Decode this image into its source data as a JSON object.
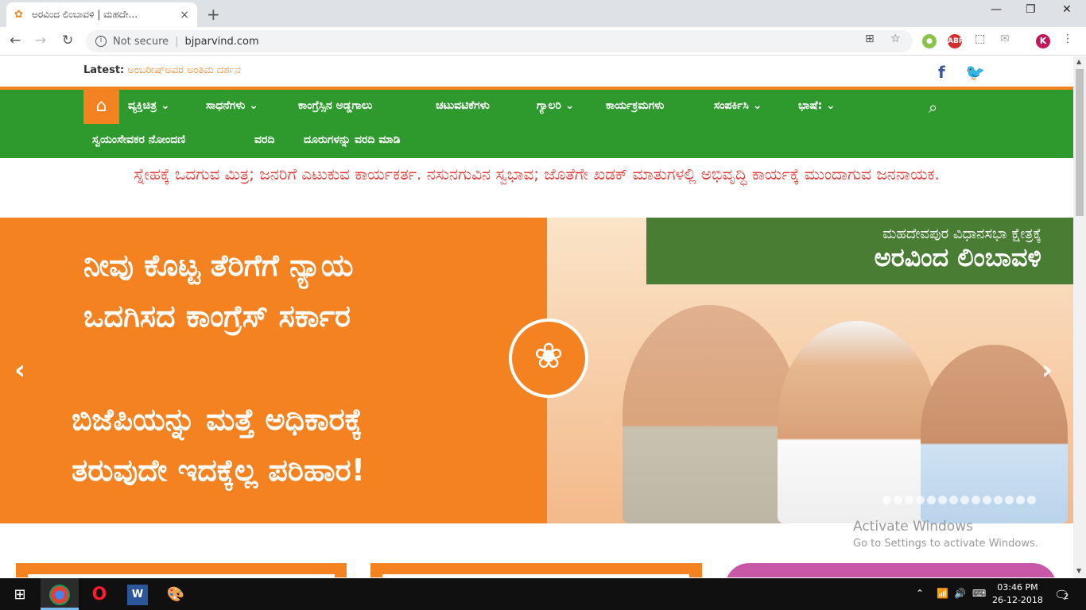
{
  "browser": {
    "tab_title": "ಅರವಿಂದ ಲಿಂಬಾವಳಿ | ಮಹದೇ...",
    "tab_close": "×",
    "new_tab": "+",
    "url_security": "Not secure",
    "url": "bjparvind.com",
    "profile_initial": "K",
    "ext_abp": "ABP"
  },
  "site": {
    "latest_label": "Latest:",
    "latest_text": "ಅಂಬರೀಷ್‌ಅವರ ಅಂತಿಮ ದರ್ಶನ",
    "menu": [
      "ವ್ಯಕ್ತಿಚಿತ್ರ ⌄",
      "ಸಾಧನೆಗಳು ⌄",
      "ಕಾಂಗ್ರೆಸ್ಸಿನ ಅಡ್ಡಗಾಲು",
      "ಚಟುವಟಿಕೆಗಳು",
      "ಗ್ಯಾಲರಿ ⌄",
      "ಕಾರ್ಯಕ್ರಮಗಳು",
      "ಸಂಪರ್ಕಿಸಿ ⌄",
      "ಭಾಷೆ: ⌄",
      "ಸ್ವಯಂಸೇವಕರ ನೋಂದಣಿ",
      "ವರದಿ",
      "ದೂರುಗಳನ್ನು ವರದಿ ಮಾಡಿ"
    ],
    "tagline": "ಸ್ನೇಹಕ್ಕೆ ಒದಗುವ ಮಿತ್ರ; ಜನರಿಗೆ ಎಟುಕುವ ಕಾರ್ಯಕರ್ತ. ನಸುನಗುವಿನ ಸ್ವಭಾವ; ಜೊತೆಗೇ ಖಡಕ್ ಮಾತುಗಳಲ್ಲಿ ಅಭಿವೃದ್ಧಿ ಕಾರ್ಯಕ್ಕೆ ಮುಂದಾಗುವ ಜನನಾಯಕ.",
    "slide": {
      "line1": "ನೀವು ಕೊಟ್ಟ ತೆರಿಗೆಗೆ ನ್ಯಾಯ",
      "line2": "ಒದಗಿಸದ ಕಾಂಗ್ರೆಸ್ ಸರ್ಕಾರ",
      "line3": "ಬಿಜೆಪಿಯನ್ನು ಮತ್ತೆ ಅಧಿಕಾರಕ್ಕೆ",
      "line4": "ತರುವುದೇ  ಇದಕ್ಕೆಲ್ಲ ಪರಿಹಾರ!",
      "constituency": "ಮಹದೇವಪುರ ವಿಧಾನಸಭಾ ಕ್ಷೇತ್ರಕ್ಕೆ",
      "candidate": "ಅರವಿಂದ ಲಿಂಬಾವಳಿ",
      "dot_count": 14
    },
    "colors": {
      "orange": "#f58220",
      "green": "#2e9a2e",
      "red": "#e53935"
    }
  },
  "watermark": {
    "title": "Activate Windows",
    "subtitle": "Go to Settings to activate Windows."
  },
  "taskbar": {
    "time": "03:46 PM",
    "date": "26-12-2018",
    "notifications": "2"
  }
}
